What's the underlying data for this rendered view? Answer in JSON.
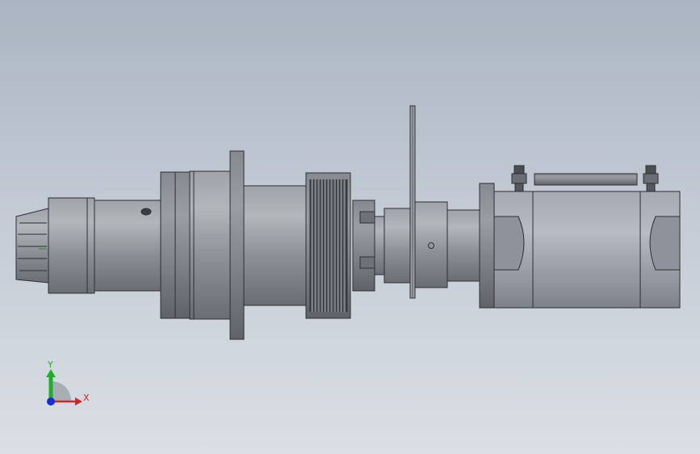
{
  "viewport": {
    "background_top": "#aab4c2",
    "background_bottom": "#dadfe5"
  },
  "triad": {
    "y_label": "Y",
    "x_label": "X",
    "y_color": "#1fae2b",
    "x_color": "#d8232a",
    "z_color": "#1a2fd0"
  },
  "model": {
    "icon": "spindle-assembly-icon",
    "metal_color": "#8d9198",
    "dark_color": "#5d6167"
  }
}
